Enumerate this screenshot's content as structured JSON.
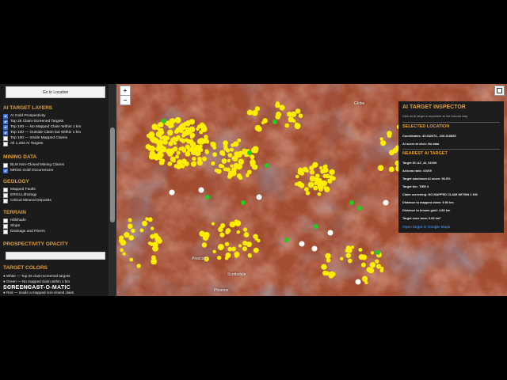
{
  "sidebar": {
    "go_button": "Go to Location",
    "sections": {
      "ai_target_layers": "AI TARGET LAYERS",
      "mining_data": "MINING DATA",
      "geology": "GEOLOGY",
      "terrain": "TERRAIN",
      "opacity": "PROSPECTIVITY OPACITY",
      "target_colors": "TARGET COLORS"
    },
    "ai_layers": [
      {
        "label": "AI Gold Prospectivity",
        "checked": true
      },
      {
        "label": "Top 25 Claim-Screened Targets",
        "checked": true
      },
      {
        "label": "Top 100 — No Mapped Claim Within 1 km",
        "checked": true
      },
      {
        "label": "Top 100 — Outside Claim but Within 1 km",
        "checked": true
      },
      {
        "label": "Top 100 — Inside Mapped Claims",
        "checked": false
      },
      {
        "label": "All 1,283 AI Targets",
        "checked": false
      }
    ],
    "mining_layers": [
      {
        "label": "BLM Non-Closed Mining Claims",
        "checked": false
      },
      {
        "label": "MRDS Gold Occurrences",
        "checked": true
      }
    ],
    "geology_layers": [
      {
        "label": "Mapped Faults",
        "checked": false
      },
      {
        "label": "ERGs Lithology",
        "checked": false
      },
      {
        "label": "Critical Mineral Deposits",
        "checked": false
      }
    ],
    "terrain_layers": [
      {
        "label": "Hillshade",
        "checked": false
      },
      {
        "label": "Slope",
        "checked": false
      },
      {
        "label": "Drainage and Rivers",
        "checked": false
      }
    ],
    "legend": [
      "● White — Top 25 claim-screened targets",
      "● Green — No mapped claim within 1 km",
      "● Yellow — Within 1 km",
      "● Red — Inside a mapped non-closed claim"
    ]
  },
  "map": {
    "zoom_in": "+",
    "zoom_out": "−",
    "labels": [
      "Prescott",
      "Scottsdale",
      "Phoenix",
      "Globe"
    ]
  },
  "inspector": {
    "title": "AI TARGET INSPECTOR",
    "hint": "Click an AI target or anywhere on the Arizona map.",
    "selected_heading": "SELECTED LOCATION",
    "coordinates": "Coordinates: 33.942072, -106.316835",
    "ai_score": "AI score at click: No data",
    "nearest_heading": "NEAREST AI TARGET",
    "target_id": "Target ID: AZ_AI_01009",
    "rank": "Arizona rank: #1009",
    "max_score": "Target maximum AI score: 96.5%",
    "tier": "Target tier: TIER 3",
    "screening": "Claim screening: NO MAPPED CLAIM WITHIN 1 KM",
    "dist_claim": "Distance to mapped claim: 9.96 km",
    "dist_gold": "Distance to known gold: 4.80 km",
    "zone_area": "Target zone area: 0.83 km²",
    "link": "Open target in Google Maps"
  },
  "watermark": "SCREENCAST-O-MATIC",
  "colors": {
    "accent": "#e0a040",
    "yellow_target": "#ffee00",
    "green_target": "#22cc22",
    "white_target": "#ffffff",
    "link": "#5aa0ff"
  }
}
